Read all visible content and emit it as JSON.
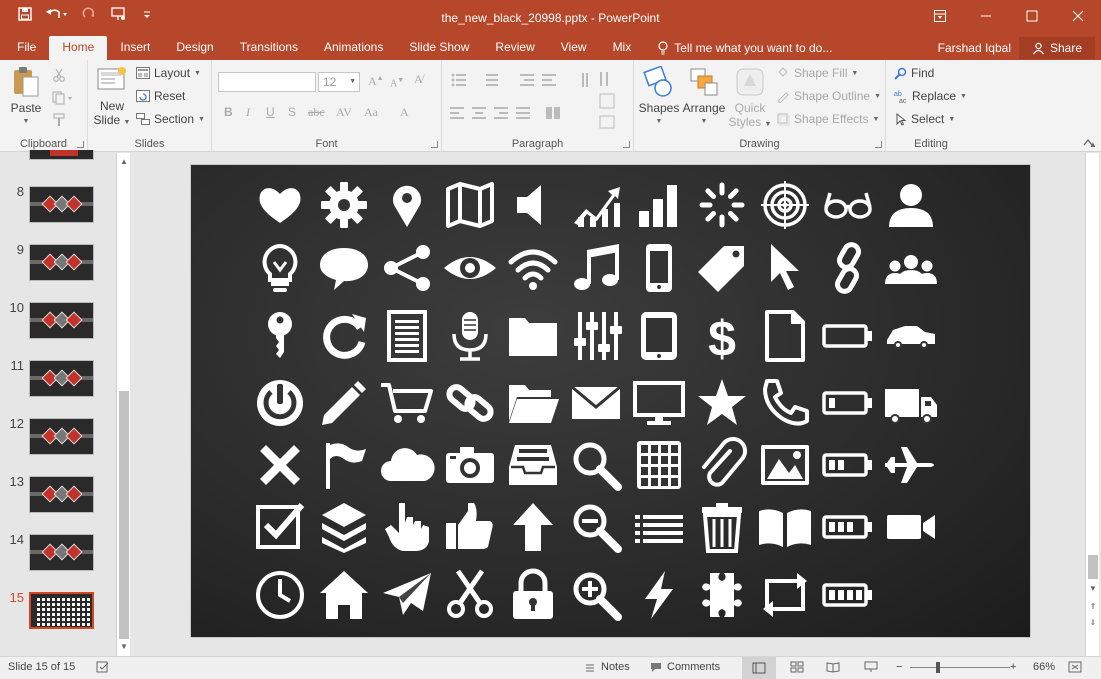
{
  "window": {
    "title": "the_new_black_20998.pptx - PowerPoint"
  },
  "tabs": [
    {
      "label": "File"
    },
    {
      "label": "Home"
    },
    {
      "label": "Insert"
    },
    {
      "label": "Design"
    },
    {
      "label": "Transitions"
    },
    {
      "label": "Animations"
    },
    {
      "label": "Slide Show"
    },
    {
      "label": "Review"
    },
    {
      "label": "View"
    },
    {
      "label": "Mix"
    }
  ],
  "active_tab": "Home",
  "tell_me": "Tell me what you want to do...",
  "user_name": "Farshad Iqbal",
  "share_label": "Share",
  "ribbon": {
    "clipboard": {
      "label": "Clipboard",
      "paste": "Paste"
    },
    "slides": {
      "label": "Slides",
      "new_slide_line1": "New",
      "new_slide_line2": "Slide",
      "layout": "Layout",
      "reset": "Reset",
      "section": "Section"
    },
    "font": {
      "label": "Font",
      "font_size": "12"
    },
    "paragraph": {
      "label": "Paragraph"
    },
    "drawing": {
      "label": "Drawing",
      "shapes": "Shapes",
      "arrange": "Arrange",
      "quick_styles_line1": "Quick",
      "quick_styles_line2": "Styles",
      "shape_fill": "Shape Fill",
      "shape_outline": "Shape Outline",
      "shape_effects": "Shape Effects"
    },
    "editing": {
      "label": "Editing",
      "find": "Find",
      "replace": "Replace",
      "select": "Select"
    }
  },
  "thumbnails": [
    {
      "number": "8"
    },
    {
      "number": "9"
    },
    {
      "number": "10"
    },
    {
      "number": "11"
    },
    {
      "number": "12"
    },
    {
      "number": "13"
    },
    {
      "number": "14"
    },
    {
      "number": "15",
      "selected": true
    }
  ],
  "slide_icons": [
    [
      "heart-icon",
      "gear-icon",
      "map-pin-icon",
      "map-icon",
      "speaker-icon",
      "growth-chart-icon",
      "bar-chart-icon",
      "loading-icon",
      "target-icon",
      "glasses-icon",
      "user-icon"
    ],
    [
      "lightbulb-icon",
      "speech-bubble-icon",
      "share-icon",
      "eye-icon",
      "wifi-icon",
      "music-note-icon",
      "mobile-phone-icon",
      "tag-icon",
      "cursor-icon",
      "chain-link-icon",
      "group-icon"
    ],
    [
      "key-icon",
      "refresh-icon",
      "document-lines-icon",
      "microphone-icon",
      "folder-icon",
      "equalizer-icon",
      "tablet-icon",
      "dollar-icon",
      "file-icon",
      "battery-empty-icon",
      "car-icon"
    ],
    [
      "power-icon",
      "pencil-icon",
      "shopping-cart-icon",
      "link-icon",
      "folder-open-icon",
      "envelope-icon",
      "monitor-icon",
      "star-icon",
      "phone-icon",
      "battery-low-icon",
      "truck-icon"
    ],
    [
      "close-x-icon",
      "flag-icon",
      "cloud-icon",
      "camera-icon",
      "inbox-tray-icon",
      "search-icon",
      "calculator-icon",
      "paperclip-icon",
      "photo-icon",
      "battery-half-icon",
      "airplane-icon"
    ],
    [
      "checkbox-icon",
      "layers-icon",
      "hand-pointer-icon",
      "thumbs-up-icon",
      "arrow-up-icon",
      "zoom-out-icon",
      "list-icon",
      "trash-icon",
      "book-icon",
      "battery-three-quarter-icon",
      "video-camera-icon"
    ],
    [
      "clock-icon",
      "home-icon",
      "paper-plane-icon",
      "scissors-icon",
      "padlock-icon",
      "zoom-in-icon",
      "lightning-icon",
      "puzzle-icon",
      "repeat-icon",
      "battery-full-icon"
    ]
  ],
  "status": {
    "slide_info": "Slide 15 of 15",
    "notes": "Notes",
    "comments": "Comments",
    "zoom": "66%"
  },
  "colors": {
    "accent": "#b7472a",
    "slide_background": "#2a2a2a",
    "icon": "#ffffff",
    "selection": "#d24726"
  }
}
